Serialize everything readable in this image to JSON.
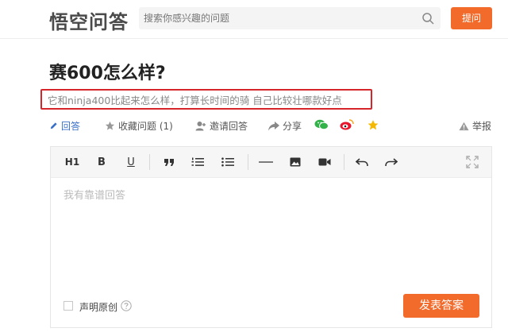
{
  "header": {
    "logo": "悟空问答",
    "search_placeholder": "搜索你感兴趣的问题",
    "ask_button": "提问"
  },
  "question": {
    "title": "赛600怎么样?",
    "description": "它和ninja400比起来怎么样，打算长时间的骑 自己比较壮哪款好点"
  },
  "actions": {
    "answer": "回答",
    "favorite": "收藏问题 (1)",
    "invite": "邀请回答",
    "share": "分享",
    "report": "举报"
  },
  "editor": {
    "toolbar": {
      "heading": "H1",
      "bold": "B",
      "underline": "U"
    },
    "placeholder": "我有靠谱回答",
    "original_label": "声明原创",
    "submit_button": "发表答案"
  },
  "colors": {
    "accent": "#f26b2b",
    "highlight_border": "#d6262b",
    "wechat": "#34b24a",
    "weibo": "#e6162d",
    "star": "#f5b800"
  }
}
